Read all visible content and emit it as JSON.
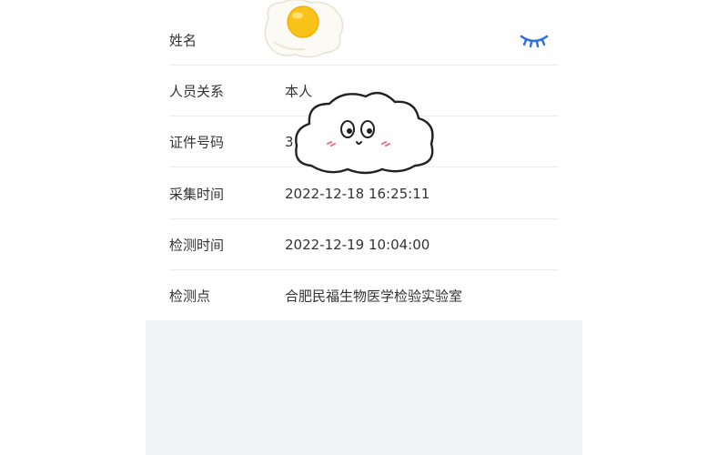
{
  "form": {
    "rows": [
      {
        "label": "姓名",
        "value": ""
      },
      {
        "label": "人员关系",
        "value": "本人"
      },
      {
        "label": "证件号码",
        "value": "3"
      },
      {
        "label": "采集时间",
        "value": "2022-12-18 16:25:11"
      },
      {
        "label": "检测时间",
        "value": "2022-12-19 10:04:00"
      },
      {
        "label": "检测点",
        "value": "合肥民福生物医学检验实验室"
      }
    ]
  },
  "icons": {
    "visibility_toggle": "eye-closed-icon",
    "sticker_top": "fried-egg-sticker",
    "sticker_middle": "cloud-face-sticker"
  },
  "colors": {
    "accent": "#2f6fe0",
    "background_lower": "#f2f3f6",
    "divider": "#ececec",
    "text": "#333333"
  }
}
